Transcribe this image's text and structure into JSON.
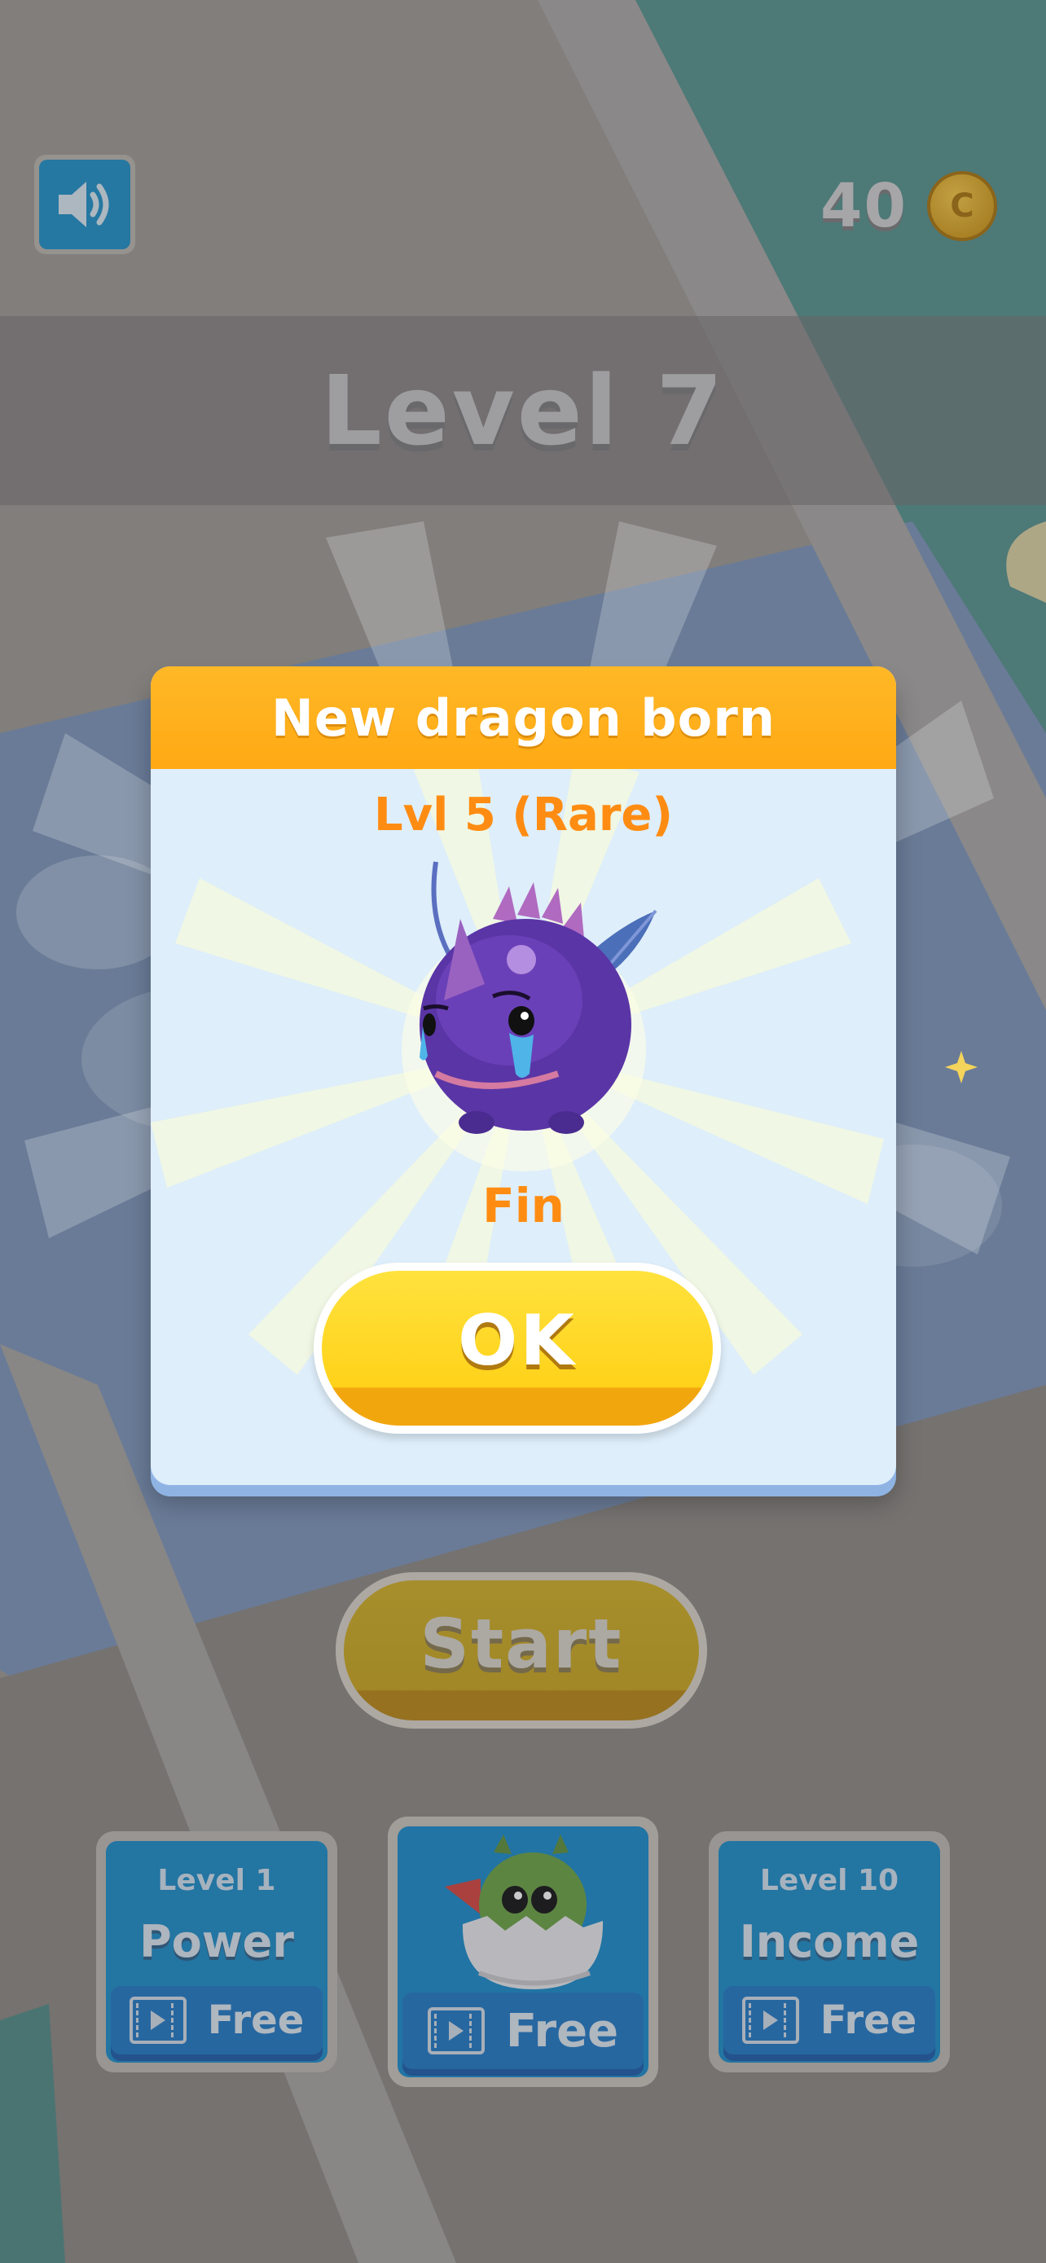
{
  "header": {
    "coin_count": "40",
    "coin_symbol": "C",
    "level_title": "Level 7"
  },
  "modal": {
    "title": "New dragon born",
    "rarity": "Lvl 5 (Rare)",
    "dragon_name": "Fin",
    "ok_label": "OK"
  },
  "start_label": "Start",
  "upgrades": [
    {
      "level": "Level 1",
      "name": "Power",
      "free": "Free"
    },
    {
      "free": "Free"
    },
    {
      "level": "Level 10",
      "name": "Income",
      "free": "Free"
    }
  ],
  "icons": {
    "sound": "speaker-icon",
    "coin": "coin-icon",
    "video": "video-ad-icon",
    "egg": "egg-dragon-icon",
    "dragon": "purple-dragon-icon"
  },
  "colors": {
    "modal_header": "#ffb21c",
    "accent_orange": "#ff8c12",
    "ok_yellow": "#ffd21a",
    "card_blue": "#1a8bc7"
  }
}
